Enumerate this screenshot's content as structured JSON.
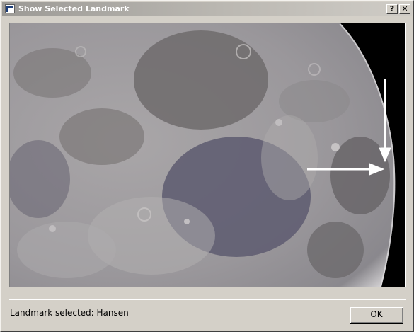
{
  "window": {
    "title": "Show Selected Landmark",
    "help_label": "?",
    "close_label": "✕"
  },
  "image": {
    "description_icon": "moon-photo"
  },
  "status": {
    "text": "Landmark selected: Hansen"
  },
  "buttons": {
    "ok_label": "OK"
  },
  "colors": {
    "dialog_bg": "#d4d0c8",
    "arrow": "#ffffff"
  }
}
